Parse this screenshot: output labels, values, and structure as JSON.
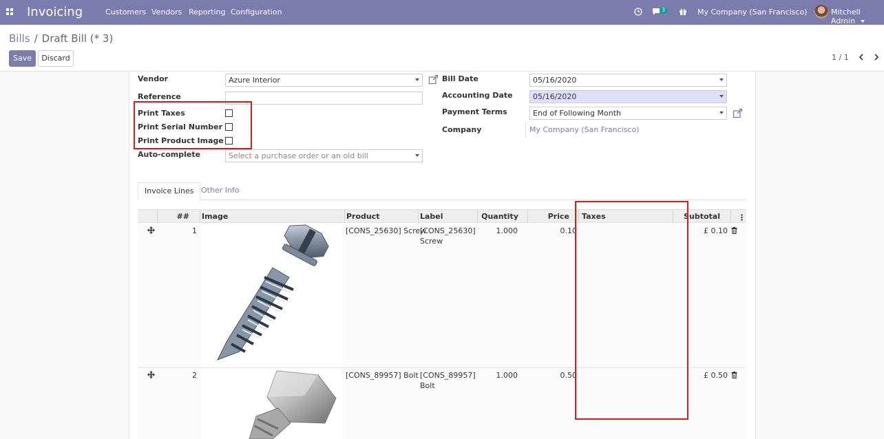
{
  "navbar": {
    "app_name": "Invoicing",
    "menu": [
      "Customers",
      "Vendors",
      "Reporting",
      "Configuration"
    ],
    "messages_count": "3",
    "company": "My Company (San Francisco)",
    "user": "Mitchell Admin",
    "bg_color": "#7c7bad"
  },
  "breadcrumb": {
    "parent": "Bills",
    "current": "Draft Bill (* 3)"
  },
  "buttons": {
    "save": "Save",
    "discard": "Discard"
  },
  "pager": {
    "value": "1 / 1"
  },
  "form": {
    "vendor_label": "Vendor",
    "vendor_value": "Azure Interior",
    "reference_label": "Reference",
    "reference_value": "",
    "print_taxes_label": "Print Taxes",
    "print_serial_label": "Print Serial Number",
    "print_image_label": "Print Product Image",
    "autocomplete_label": "Auto-complete",
    "autocomplete_placeholder": "Select a purchase order or an old bill",
    "bill_date_label": "Bill Date",
    "bill_date_value": "05/16/2020",
    "accounting_date_label": "Accounting Date",
    "accounting_date_value": "05/16/2020",
    "payment_terms_label": "Payment Terms",
    "payment_terms_value": "End of Following Month",
    "company_label": "Company",
    "company_value": "My Company (San Francisco)"
  },
  "tabs": [
    "Invoice Lines",
    "Other Info"
  ],
  "table": {
    "headers": {
      "seq": "##",
      "image": "Image",
      "product": "Product",
      "label": "Label",
      "quantity": "Quantity",
      "price": "Price",
      "taxes": "Taxes",
      "subtotal": "Subtotal"
    },
    "rows": [
      {
        "seq": "1",
        "product": "[CONS_25630] Screw",
        "label_line1": "[CONS_25630]",
        "label_line2": "Screw",
        "quantity": "1.000",
        "price": "0.10",
        "taxes": "",
        "subtotal": "£ 0.10"
      },
      {
        "seq": "2",
        "product": "[CONS_89957] Bolt",
        "label_line1": "[CONS_89957]",
        "label_line2": "Bolt",
        "quantity": "1.000",
        "price": "0.50",
        "taxes": "",
        "subtotal": "£ 0.50"
      }
    ]
  }
}
